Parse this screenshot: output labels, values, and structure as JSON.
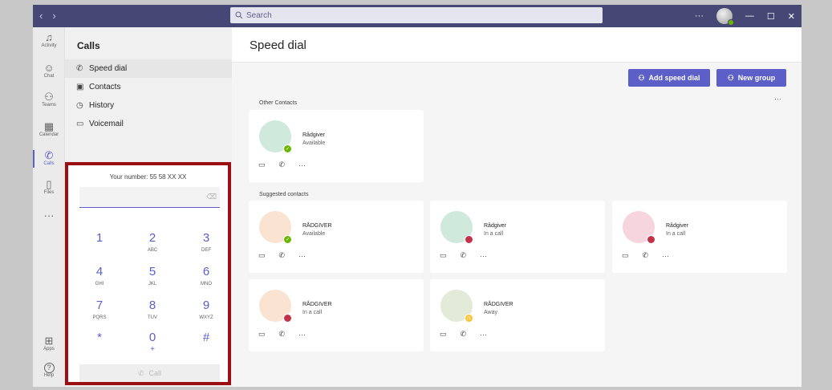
{
  "titlebar": {
    "back_glyph": "‹",
    "forward_glyph": "›",
    "search_placeholder": "Search",
    "more_glyph": "···",
    "minimize_glyph": "—",
    "maximize_glyph": "☐",
    "close_glyph": "✕"
  },
  "rail": {
    "items": [
      {
        "label": "Activity",
        "icon": "bell-icon",
        "glyph": "♫"
      },
      {
        "label": "Chat",
        "icon": "chat-icon",
        "glyph": "☺"
      },
      {
        "label": "Teams",
        "icon": "teams-icon",
        "glyph": "⚇"
      },
      {
        "label": "Calendar",
        "icon": "calendar-icon",
        "glyph": "▦"
      },
      {
        "label": "Calls",
        "icon": "phone-icon",
        "glyph": "✆"
      },
      {
        "label": "Files",
        "icon": "file-icon",
        "glyph": "▯"
      },
      {
        "label": "",
        "icon": "more-icon",
        "glyph": "···"
      },
      {
        "label": "Apps",
        "icon": "apps-icon",
        "glyph": "⊞"
      },
      {
        "label": "Help",
        "icon": "help-icon",
        "glyph": "?"
      }
    ]
  },
  "calls_panel": {
    "title": "Calls",
    "nav": [
      {
        "label": "Speed dial",
        "icon": "phone-icon",
        "glyph": "✆"
      },
      {
        "label": "Contacts",
        "icon": "contacts-icon",
        "glyph": "▣"
      },
      {
        "label": "History",
        "icon": "clock-icon",
        "glyph": "◷"
      },
      {
        "label": "Voicemail",
        "icon": "voicemail-icon",
        "glyph": "▭"
      }
    ]
  },
  "dialpad": {
    "your_number": "Your number: 55 58  XX XX",
    "backspace_glyph": "⌫",
    "keys": [
      {
        "digit": "1",
        "letters": ""
      },
      {
        "digit": "2",
        "letters": "ABC"
      },
      {
        "digit": "3",
        "letters": "DEF"
      },
      {
        "digit": "4",
        "letters": "GHI"
      },
      {
        "digit": "5",
        "letters": "JKL"
      },
      {
        "digit": "6",
        "letters": "MNO"
      },
      {
        "digit": "7",
        "letters": "PQRS"
      },
      {
        "digit": "8",
        "letters": "TUV"
      },
      {
        "digit": "9",
        "letters": "WXYZ"
      },
      {
        "digit": "*",
        "letters": ""
      },
      {
        "digit": "0",
        "letters": "+"
      },
      {
        "digit": "#",
        "letters": ""
      }
    ],
    "call_label": "Call",
    "call_glyph": "✆"
  },
  "main": {
    "title": "Speed dial",
    "add_speed_dial_label": "Add speed dial",
    "new_group_label": "New group",
    "add_glyph": "⚇",
    "more_glyph": "···",
    "other_contacts_label": "Other Contacts",
    "suggested_contacts_label": "Suggested contacts",
    "card_video_glyph": "▭",
    "card_call_glyph": "✆",
    "card_more_glyph": "···",
    "other_contacts": [
      {
        "name": "Rådgiver",
        "status": "Available",
        "avatar_color": "#cfe9dd",
        "status_color": "#6bb700",
        "status_glyph": "✓"
      }
    ],
    "suggested_contacts": [
      {
        "name": "RÅDGIVER",
        "status": "Available",
        "avatar_color": "#fbe3d1",
        "status_color": "#6bb700",
        "status_glyph": "✓"
      },
      {
        "name": "Rådgiver",
        "status": "In a call",
        "avatar_color": "#cfe9dd",
        "status_color": "#c4314b",
        "status_glyph": ""
      },
      {
        "name": "Rådgiver",
        "status": "In a call",
        "avatar_color": "#f6d5de",
        "status_color": "#c4314b",
        "status_glyph": ""
      },
      {
        "name": "RÅDGIVER",
        "status": "In a call",
        "avatar_color": "#fbe3d1",
        "status_color": "#c4314b",
        "status_glyph": ""
      },
      {
        "name": "RÅDGIVER",
        "status": "Away",
        "avatar_color": "#e3ead7",
        "status_color": "#f8c12d",
        "status_glyph": "◷"
      }
    ]
  }
}
